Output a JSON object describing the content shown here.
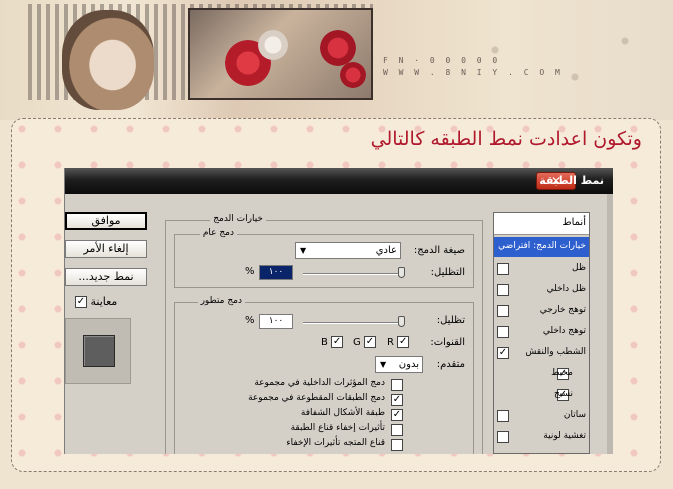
{
  "heading": "وتكون اعدادت نمط الطبقه كالتالي",
  "banner": {
    "site_line1": "F N · 0 0 0 0 0",
    "site_line2": "W W W . 8 N I Y . C O M"
  },
  "dialog": {
    "title": "نمط الطبقة",
    "close_glyph": "✕",
    "buttons": {
      "ok": "موافق",
      "cancel": "إلغاء الأمر",
      "new_style": "نمط جديد..."
    },
    "preview": {
      "label": "معاينة",
      "checked": "✓"
    },
    "blending_options": {
      "legend": "خيارات الدمج",
      "general": {
        "legend": "دمج عام",
        "mode_label": "صيغة الدمج:",
        "mode_value": "عادي",
        "opacity_label": "التظليل:",
        "opacity_value": "١٠٠",
        "percent": "%"
      },
      "advanced": {
        "legend": "دمج متطور",
        "fill_label": "تظليل:",
        "fill_value": "١٠٠",
        "percent": "%",
        "channels_label": "القنوات:",
        "channels": [
          {
            "name": "R",
            "checked": "✓"
          },
          {
            "name": "G",
            "checked": "✓"
          },
          {
            "name": "B",
            "checked": "✓"
          }
        ],
        "knockout_label": "متقدم:",
        "knockout_value": "بدون",
        "options": [
          {
            "label": "دمج المؤثرات الداخلية في مجموعة",
            "checked": ""
          },
          {
            "label": "دمج الطبقات المقطوعة في مجموعة",
            "checked": "✓"
          },
          {
            "label": "طبقة الأشكال الشفافة",
            "checked": "✓"
          },
          {
            "label": "تأثيرات إخفاء قناع الطبقة",
            "checked": ""
          },
          {
            "label": "قناع المتجه تأثيرات الإخفاء",
            "checked": ""
          }
        ]
      }
    },
    "styles": {
      "header": "أنماط",
      "items": [
        {
          "label": "خيارات الدمج: افتراضي",
          "checked": null,
          "active": true
        },
        {
          "label": "ظل",
          "checked": ""
        },
        {
          "label": "ظل داخلي",
          "checked": ""
        },
        {
          "label": "توهج خارجي",
          "checked": ""
        },
        {
          "label": "توهج داخلي",
          "checked": ""
        },
        {
          "label": "الشطب والنقش",
          "checked": "✓"
        },
        {
          "label": "محيط",
          "checked": "✓",
          "sub": true
        },
        {
          "label": "نسيج",
          "checked": "✓",
          "sub": true
        },
        {
          "label": "ساتان",
          "checked": ""
        },
        {
          "label": "تغشية لونية",
          "checked": ""
        }
      ]
    }
  },
  "colors": {
    "heading": "#b0182c",
    "active_item": "#2d5fcf",
    "titlebar": "#1e1e1e",
    "close_button": "#c02b16"
  }
}
